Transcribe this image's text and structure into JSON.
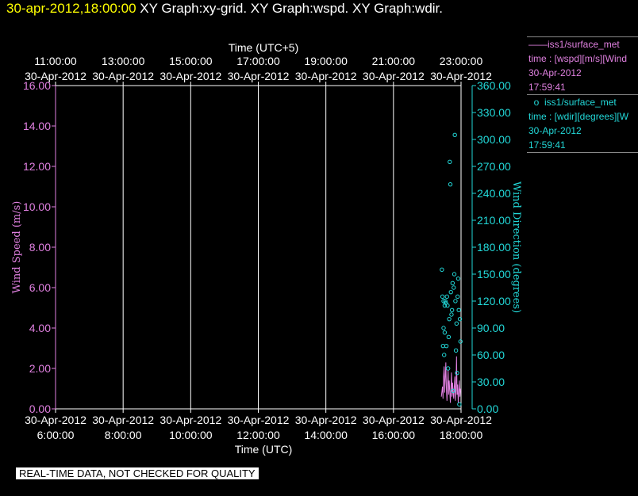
{
  "header": {
    "timestamp": "30-apr-2012,18:00:00",
    "graphs": "XY Graph:xy-grid.  XY Graph:wspd.  XY Graph:wdir."
  },
  "legend": {
    "wspd": {
      "name": "iss1/surface_met",
      "line2": "time : [wspd][m/s][Wind",
      "line3": "30-Apr-2012",
      "line4": "17:59:41"
    },
    "wdir": {
      "name": "iss1/surface_met",
      "line2": "time : [wdir][degrees][W",
      "line3": "30-Apr-2012",
      "line4": "17:59:41"
    }
  },
  "qc_notice": "REAL-TIME DATA, NOT CHECKED FOR QUALITY",
  "colors": {
    "wspd": "#e080e0",
    "wdir": "#22d8d8",
    "grid": "#ffffff",
    "text": "#ffffff"
  },
  "chart_data": {
    "type": "line",
    "grid": true,
    "x_bottom": {
      "label": "Time (UTC)",
      "ticks": [
        {
          "date": "30-Apr-2012",
          "time": "6:00:00"
        },
        {
          "date": "30-Apr-2012",
          "time": "8:00:00"
        },
        {
          "date": "30-Apr-2012",
          "time": "10:00:00"
        },
        {
          "date": "30-Apr-2012",
          "time": "12:00:00"
        },
        {
          "date": "30-Apr-2012",
          "time": "14:00:00"
        },
        {
          "date": "30-Apr-2012",
          "time": "16:00:00"
        },
        {
          "date": "30-Apr-2012",
          "time": "18:00:00"
        }
      ],
      "range": [
        "30-Apr-2012 06:00:00",
        "30-Apr-2012 18:00:00"
      ]
    },
    "x_top": {
      "label": "Time (UTC+5)",
      "ticks": [
        {
          "date": "30-Apr-2012",
          "time": "11:00:00"
        },
        {
          "date": "30-Apr-2012",
          "time": "13:00:00"
        },
        {
          "date": "30-Apr-2012",
          "time": "15:00:00"
        },
        {
          "date": "30-Apr-2012",
          "time": "17:00:00"
        },
        {
          "date": "30-Apr-2012",
          "time": "19:00:00"
        },
        {
          "date": "30-Apr-2012",
          "time": "21:00:00"
        },
        {
          "date": "30-Apr-2012",
          "time": "23:00:00"
        }
      ]
    },
    "y_left": {
      "label": "Wind Speed (m/s)",
      "ylim": [
        0,
        16
      ],
      "ticks": [
        "0.00",
        "2.00",
        "4.00",
        "6.00",
        "8.00",
        "10.00",
        "12.00",
        "14.00",
        "16.00"
      ]
    },
    "y_right": {
      "label": "Wind Direction (degrees)",
      "ylim": [
        0,
        360
      ],
      "ticks": [
        "0.00",
        "30.00",
        "60.00",
        "90.00",
        "120.00",
        "150.00",
        "180.00",
        "210.00",
        "240.00",
        "270.00",
        "300.00",
        "330.00",
        "360.00"
      ]
    },
    "series": [
      {
        "name": "iss1/surface_met",
        "axis": "left",
        "style": "line",
        "x": [
          "17:25",
          "17:27",
          "17:28",
          "17:29",
          "17:30",
          "17:31",
          "17:32",
          "17:33",
          "17:34",
          "17:35",
          "17:36",
          "17:37",
          "17:38",
          "17:39",
          "17:40",
          "17:41",
          "17:42",
          "17:43",
          "17:44",
          "17:45",
          "17:46",
          "17:47",
          "17:48",
          "17:49",
          "17:50",
          "17:51",
          "17:52",
          "17:53",
          "17:54",
          "17:55",
          "17:56",
          "17:57",
          "17:58",
          "17:59"
        ],
        "y": [
          0.6,
          1.1,
          0.5,
          1.6,
          2.1,
          0.8,
          1.5,
          2.3,
          1.0,
          0.4,
          1.2,
          1.9,
          0.7,
          1.4,
          0.9,
          0.3,
          1.0,
          1.8,
          0.6,
          1.3,
          0.8,
          0.5,
          1.1,
          1.6,
          0.4,
          0.9,
          2.6,
          0.7,
          1.2,
          0.3,
          0.8,
          1.4,
          0.6,
          1.0
        ]
      },
      {
        "name": "iss1/surface_met",
        "axis": "right",
        "style": "circle",
        "x": [
          "17:26",
          "17:27",
          "17:28",
          "17:29",
          "17:29",
          "17:30",
          "17:31",
          "17:31",
          "17:32",
          "17:33",
          "17:34",
          "17:35",
          "17:36",
          "17:37",
          "17:38",
          "17:39",
          "17:40",
          "17:41",
          "17:42",
          "17:43",
          "17:44",
          "17:45",
          "17:46",
          "17:47",
          "17:48",
          "17:49",
          "17:50",
          "17:51",
          "17:52",
          "17:53",
          "17:54",
          "17:55",
          "17:56",
          "17:57",
          "17:58",
          "17:59"
        ],
        "y": [
          155,
          125,
          70,
          90,
          120,
          60,
          115,
          85,
          120,
          118,
          70,
          125,
          115,
          45,
          80,
          100,
          275,
          250,
          130,
          105,
          110,
          140,
          20,
          135,
          150,
          305,
          120,
          65,
          95,
          40,
          125,
          145,
          110,
          5,
          100,
          75
        ]
      }
    ]
  }
}
